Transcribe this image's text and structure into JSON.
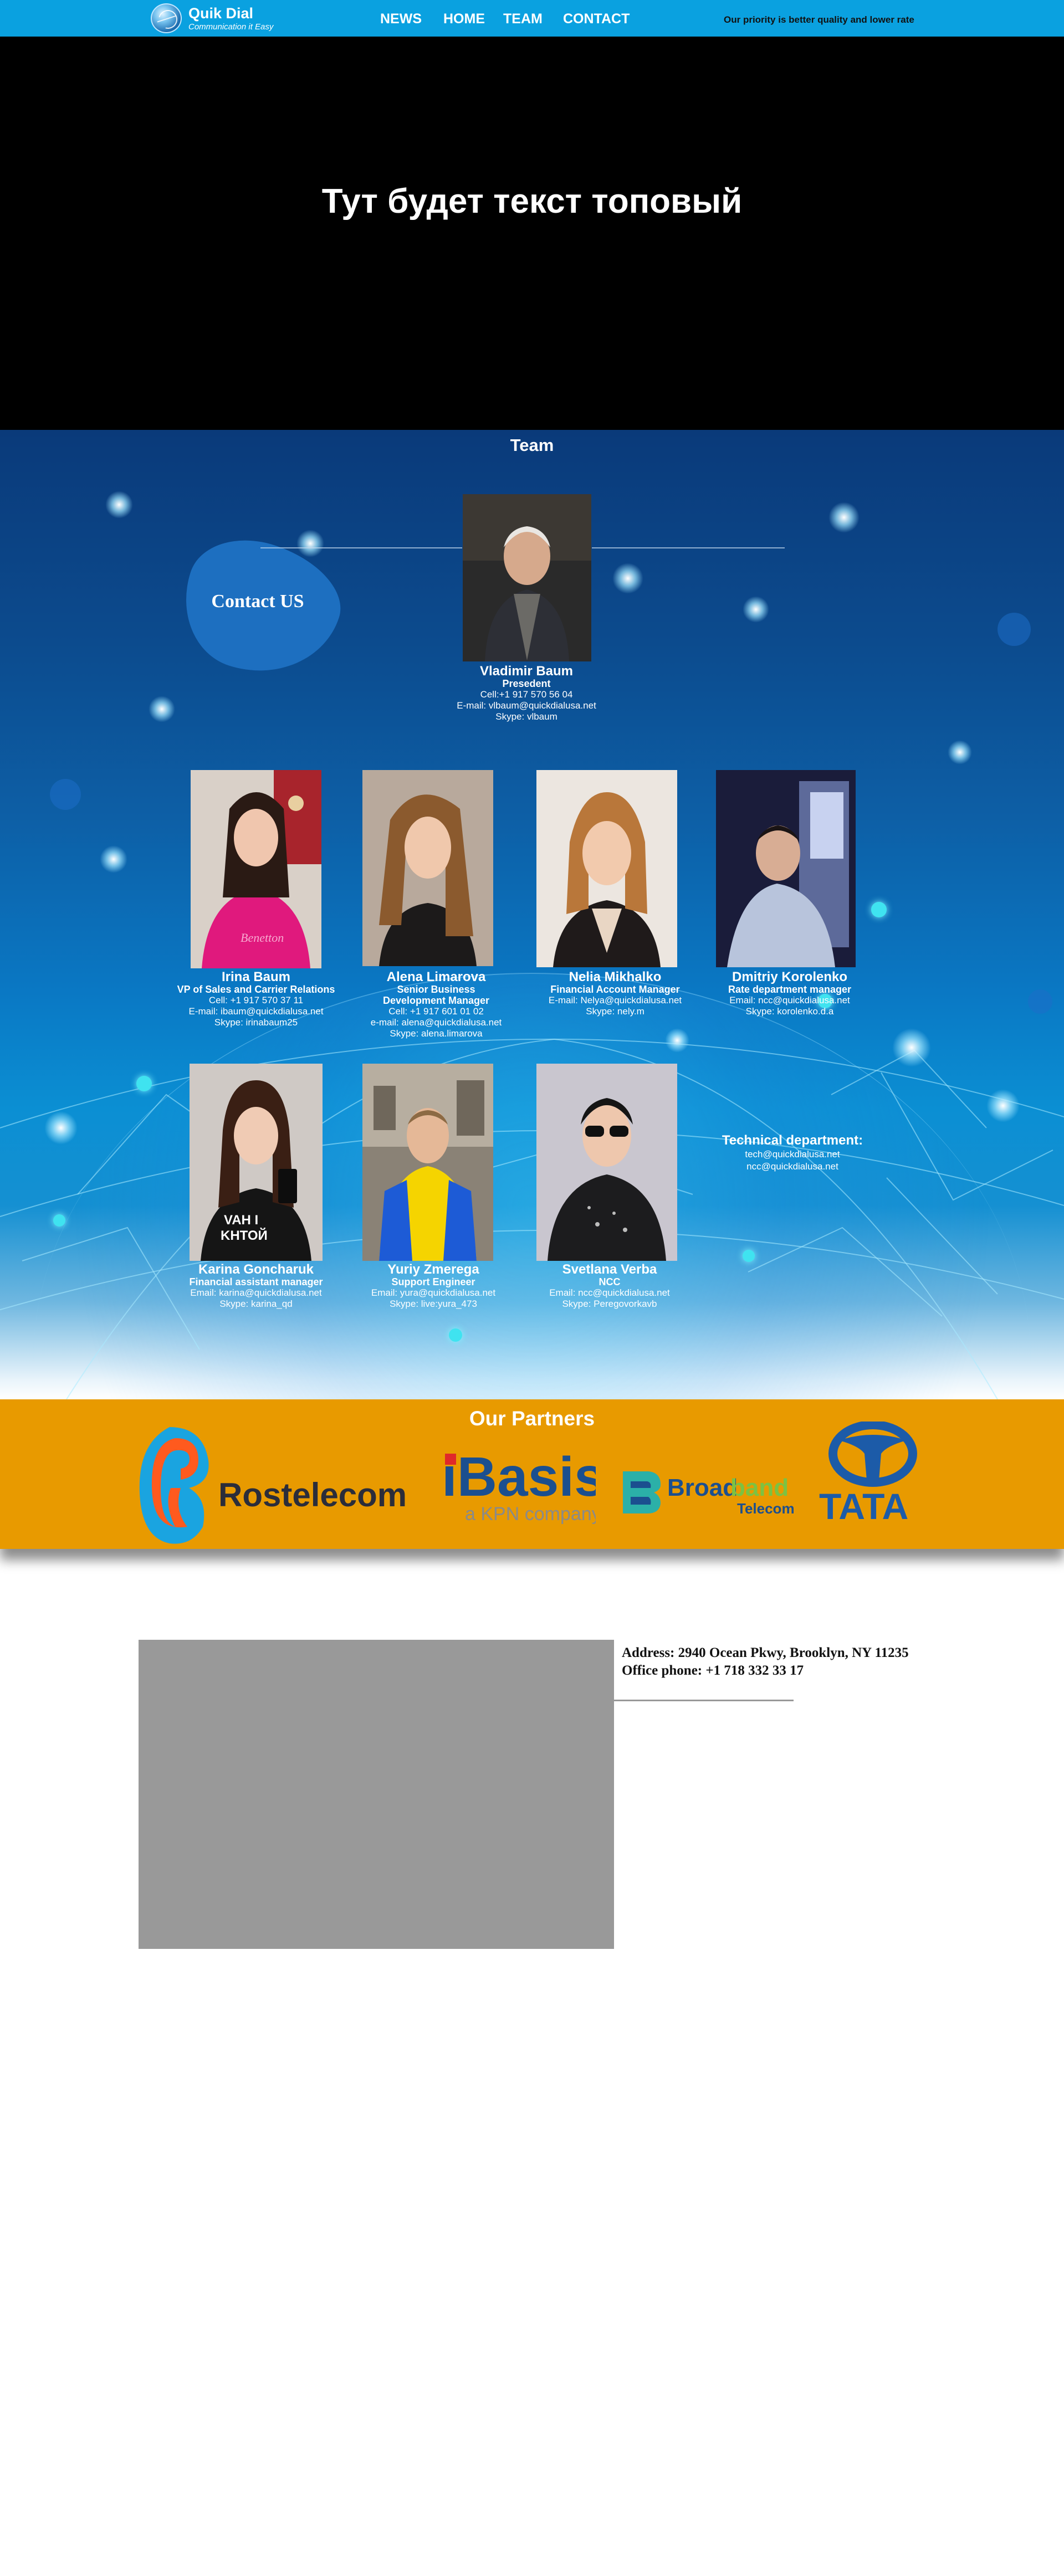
{
  "nav": {
    "brand_name": "Quik Dial",
    "brand_tagline": "Communication it Easy",
    "links": [
      "NEWS",
      "HOME",
      "TEAM",
      "CONTACT"
    ],
    "tagline_right": "Our priority is better quality and lower rate"
  },
  "hero": {
    "title": "Тут будет текст топовый"
  },
  "team": {
    "title": "Team",
    "contact_button": "Contact US",
    "lead": {
      "name": "Vladimir Baum",
      "role": "Presedent",
      "lines": [
        "Cell:+1 917 570 56 04",
        "E-mail: vlbaum@quickdialusa.net",
        "Skype: vlbaum"
      ]
    },
    "members": [
      {
        "name": "Irina Baum",
        "role": "VP of Sales and Carrier Relations",
        "role2": "",
        "lines": [
          "Cell: +1 917 570 37 11",
          "E-mail: ibaum@quickdialusa.net",
          "Skype: irinabaum25"
        ]
      },
      {
        "name": "Alena Limarova",
        "role": "Senior Business",
        "role2": "Development Manager",
        "lines": [
          "Cell: +1 917 601 01 02",
          "e-mail: alena@quickdialusa.net",
          "Skype: alena.limarova"
        ]
      },
      {
        "name": "Nelia Mikhalko",
        "role": "Financial Account Manager",
        "role2": "",
        "lines": [
          "E-mail: Nelya@quickdialusa.net",
          "Skype: nely.m",
          ""
        ]
      },
      {
        "name": "Dmitriy Korolenko",
        "role": "Rate department manager",
        "role2": "",
        "lines": [
          "Email: ncc@quickdialusa.net",
          "Skype: korolenko.d.a",
          ""
        ]
      },
      {
        "name": "Karina Goncharuk",
        "role": "Financial assistant manager",
        "role2": "",
        "lines": [
          "Email: karina@quickdialusa.net",
          "Skype: karina_qd",
          ""
        ]
      },
      {
        "name": "Yuriy Zmerega",
        "role": "Support Engineer",
        "role2": "",
        "lines": [
          "Email: yura@quickdialusa.net",
          "Skype: live:yura_473",
          ""
        ]
      },
      {
        "name": "Svetlana Verba",
        "role": "NCC",
        "role2": "",
        "lines": [
          "Email: ncc@quickdialusa.net",
          "Skype: Peregovorkavb",
          ""
        ]
      }
    ],
    "tech": {
      "title": "Technical department:",
      "lines": [
        "tech@quickdialusa.net",
        "ncc@quickdialusa.net"
      ]
    },
    "shirt_text": [
      "VAH I",
      "KHTOЙ"
    ],
    "sweater_text": "Benetton"
  },
  "partners": {
    "title": "Our Partners",
    "logos": [
      {
        "name": "Rostelecom",
        "wordmark": "Rostelecom"
      },
      {
        "name": "iBasis",
        "wordmark": "iBasis",
        "sub": "a KPN company"
      },
      {
        "name": "Broadband Telecom",
        "wordmark_1": "Broad",
        "wordmark_2": "band",
        "sub": "Telecom"
      },
      {
        "name": "TATA",
        "wordmark": "TATA"
      }
    ]
  },
  "contact": {
    "address": "Address: 2940 Ocean Pkwy, Brooklyn, NY 11235",
    "phone": "Office phone: +1 718 332 33 17"
  },
  "colors": {
    "nav_bar": "#0aa1e0",
    "partners_bar": "#e89a00",
    "map_placeholder": "#999999"
  }
}
